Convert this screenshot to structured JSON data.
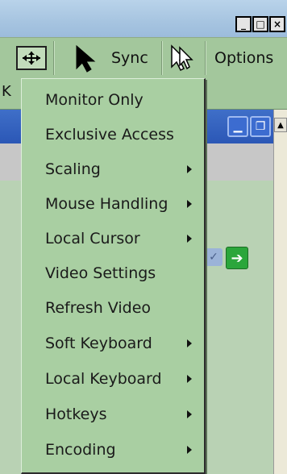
{
  "toolbar": {
    "sync_label": "Sync",
    "options_label": "Options",
    "partial_text": "K"
  },
  "window_controls": {
    "minimize": "_",
    "maximize": "□",
    "close": "×"
  },
  "menu": {
    "items": [
      {
        "label": "Monitor Only",
        "has_submenu": false
      },
      {
        "label": "Exclusive Access",
        "has_submenu": false
      },
      {
        "label": "Scaling",
        "has_submenu": true
      },
      {
        "label": "Mouse Handling",
        "has_submenu": true
      },
      {
        "label": "Local Cursor",
        "has_submenu": true
      },
      {
        "label": "Video Settings",
        "has_submenu": false
      },
      {
        "label": "Refresh Video",
        "has_submenu": false
      },
      {
        "label": "Soft Keyboard",
        "has_submenu": true
      },
      {
        "label": "Local Keyboard",
        "has_submenu": true
      },
      {
        "label": "Hotkeys",
        "has_submenu": true
      },
      {
        "label": "Encoding",
        "has_submenu": true
      }
    ]
  },
  "icons": {
    "fit": "fit-window-icon",
    "pointer": "pointer-icon",
    "single_cursor": "single-cursor-icon"
  },
  "colors": {
    "menu_bg": "#a9cfa2",
    "toolbar_bg": "#a3c79c",
    "title_bar": "#a6c4e0"
  }
}
